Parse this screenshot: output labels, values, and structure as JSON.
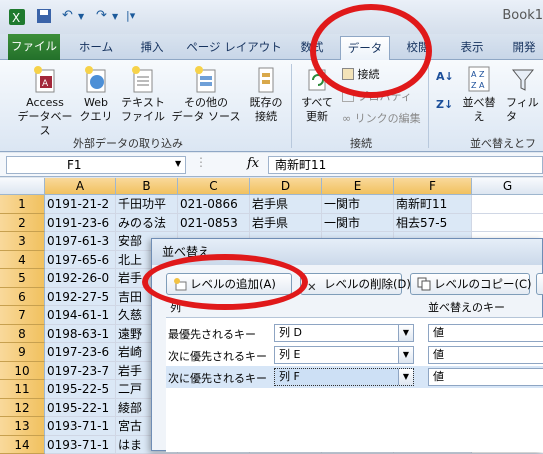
{
  "window": {
    "title": "Book1"
  },
  "tabs": [
    "ファイル",
    "ホーム",
    "挿入",
    "ページ レイアウト",
    "数式",
    "データ",
    "校閲",
    "表示",
    "開発"
  ],
  "ribbon": {
    "access": "Access\nデータベース",
    "web": "Web\nクエリ",
    "text": "テキスト\nファイル",
    "other": "その他の\nデータ ソース",
    "existing": "既存の\n接続",
    "refresh": "すべて\n更新",
    "connections": "接続",
    "properties": "プロパティ",
    "links": "リンクの編集",
    "sort": "並べ替え",
    "filter": "フィルタ",
    "group_external": "外部データの取り込み",
    "group_connections": "接続",
    "group_sort": "並べ替えとフ"
  },
  "formula": {
    "name_box": "F1",
    "fx": "fx",
    "content": "南新町11"
  },
  "columns": [
    "A",
    "B",
    "C",
    "D",
    "E",
    "F",
    "G"
  ],
  "rows": [
    [
      "0191-21-2",
      "千田功平",
      "021-0866",
      "岩手県",
      "一関市",
      "南新町11"
    ],
    [
      "0191-23-6",
      "みのる法",
      "021-0853",
      "岩手県",
      "一関市",
      "相去57-5"
    ],
    [
      "0197-61-3",
      "安部",
      "",
      "",
      "",
      ""
    ],
    [
      "0197-65-6",
      "北上",
      "",
      "",
      "",
      ""
    ],
    [
      "0192-26-0",
      "岩手",
      "",
      "",
      "",
      ""
    ],
    [
      "0192-27-5",
      "吉田",
      "",
      "",
      "",
      ""
    ],
    [
      "0194-61-1",
      "久慈",
      "",
      "",
      "",
      ""
    ],
    [
      "0198-63-1",
      "遠野",
      "",
      "",
      "",
      ""
    ],
    [
      "0197-23-6",
      "岩崎",
      "",
      "",
      "",
      ""
    ],
    [
      "0197-23-7",
      "岩手",
      "",
      "",
      "",
      ""
    ],
    [
      "0195-22-5",
      "二戸",
      "",
      "",
      "",
      ""
    ],
    [
      "0195-22-1",
      "綾部",
      "",
      "",
      "",
      ""
    ],
    [
      "0193-71-1",
      "宮古",
      "",
      "",
      "",
      ""
    ],
    [
      "0193-71-1",
      "はま",
      "",
      "",
      "",
      ""
    ]
  ],
  "dialog": {
    "title": "並べ替え",
    "add_level": "レベルの追加(A)",
    "delete_level": "レベルの削除(D)",
    "copy_level": "レベルのコピー(C)",
    "col_header": "列",
    "key_header": "並べ替えのキー",
    "levels": [
      {
        "label": "最優先されるキー",
        "column": "列 D",
        "key": "値"
      },
      {
        "label": "次に優先されるキー",
        "column": "列 E",
        "key": "値"
      },
      {
        "label": "次に優先されるキー",
        "column": "列 F",
        "key": "値"
      }
    ]
  },
  "colors": {
    "highlight_ring": "#e0191a",
    "file_tab": "#2b7a2f",
    "selection": "#dbe8f6"
  }
}
